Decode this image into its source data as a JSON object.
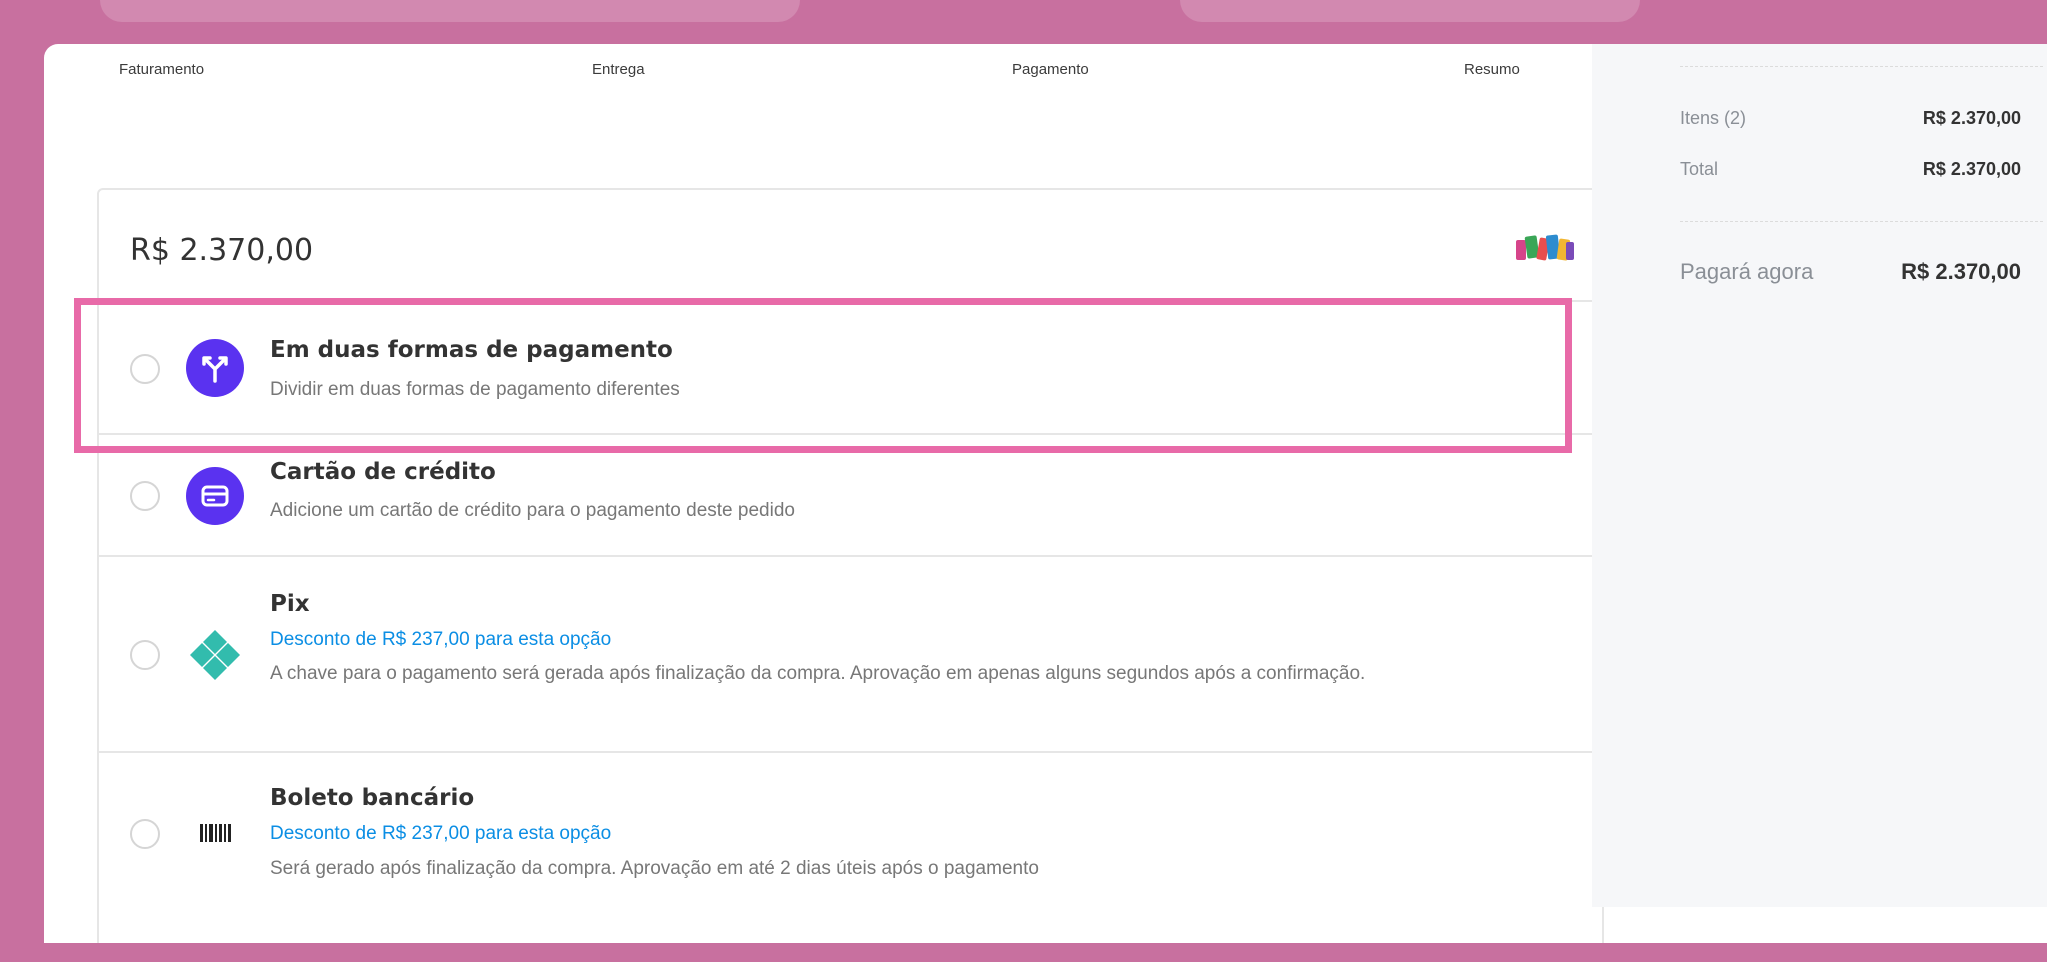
{
  "steps": [
    "Faturamento",
    "Entrega",
    "Pagamento",
    "Resumo"
  ],
  "payment": {
    "amount": "R$ 2.370,00",
    "options": [
      {
        "title": "Em duas formas de pagamento",
        "description": "Dividir em duas formas de pagamento diferentes",
        "icon": "split-arrows-icon"
      },
      {
        "title": "Cartão de crédito",
        "description": "Adicione um cartão de crédito para o pagamento deste pedido",
        "icon": "credit-card-icon"
      },
      {
        "title": "Pix",
        "discount": "Desconto de R$ 237,00 para esta opção",
        "description": "A chave para o pagamento será gerada após finalização da compra. Aprovação em apenas alguns segundos após a confirmação.",
        "icon": "pix-icon"
      },
      {
        "title": "Boleto bancário",
        "discount": "Desconto de R$ 237,00 para esta opção",
        "description": "Será gerado após finalização da compra. Aprovação em até 2 dias úteis após o pagamento",
        "icon": "barcode-icon"
      }
    ]
  },
  "summary": {
    "items_label": "Itens (2)",
    "items_value": "R$ 2.370,00",
    "total_label": "Total",
    "total_value": "R$ 2.370,00",
    "pay_now_label": "Pagará agora",
    "pay_now_value": "R$ 2.370,00"
  },
  "colors": {
    "accent_purple": "#5a32f0",
    "pix_teal": "#32bcad",
    "discount_blue": "#0b8ee4",
    "highlight_pink": "#e86aa8",
    "background": "#c8709f"
  }
}
